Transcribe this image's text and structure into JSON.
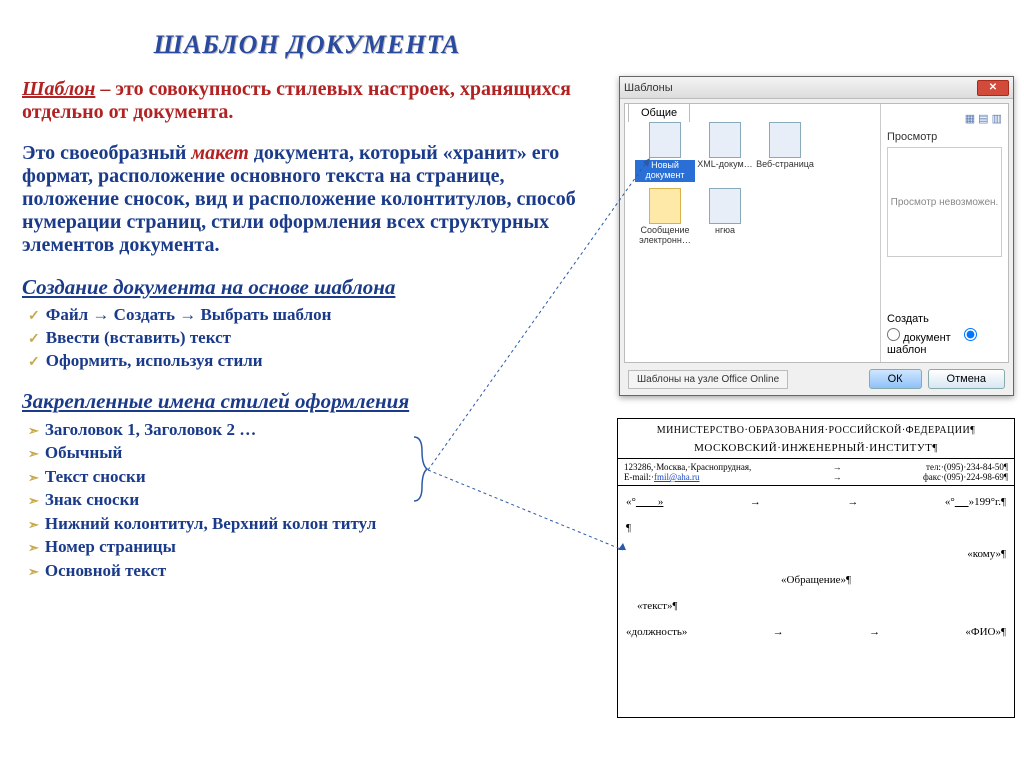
{
  "title": "ШАБЛОН ДОКУМЕНТА",
  "p1_term": "Шаблон",
  "p1_rest": " – это совокупность стилевых настроек, хранящихся отдельно от документа.",
  "p2_a": "Это своеобразный ",
  "p2_em": "макет",
  "p2_b": " документа, который  «хранит» его формат, расположение основного текста на странице, положение сносок, вид и расположение колонтитулов, способ нумерации страниц, стили оформления всех структурных элементов документа.",
  "sub1": "Создание документа на основе шаблона",
  "steps": [
    "Файл → Создать → Выбрать шаблон",
    "Ввести (вставить) текст",
    "Оформить, используя стили"
  ],
  "sub2": "Закрепленные имена стилей оформления",
  "styles": [
    "Заголовок 1, Заголовок 2 …",
    "Обычный",
    "Текст сноски",
    "Знак сноски",
    "Нижний колонтитул, Верхний колон титул",
    "Номер страницы",
    "Основной текст"
  ],
  "dialog": {
    "title": "Шаблоны",
    "tab": "Общие",
    "items": {
      "a": "Новый документ",
      "b": "XML-докум…",
      "c": "Веб-страница",
      "d": "Сообщение электронн…",
      "e": "нгюа"
    },
    "previewLbl": "Просмотр",
    "previewMsg": "Просмотр невозможен.",
    "createLbl": "Создать",
    "r1": "документ",
    "r2": "шаблон",
    "link": "Шаблоны на узле Office Online",
    "ok": "ОК",
    "cancel": "Отмена"
  },
  "doc": {
    "l1": "МИНИСТЕРСТВО·ОБРАЗОВАНИЯ·РОССИЙСКОЙ·ФЕДЕРАЦИИ¶",
    "l2": "МОСКОВСКИЙ·ИНЖЕНЕРНЫЙ·ИНСТИТУТ¶",
    "addr": "123286,·Москва,·Краснопрудная,",
    "email_lbl": "E-mail:·",
    "email": "fmil@aha.ru",
    "tel": "тел:·(095)·234-84-50¶",
    "fax": "факс·(095)·224-98-69¶",
    "dateL": "«°",
    "dateR": "199°г.¶",
    "komu": "«кому»¶",
    "obr": "«Обращение»¶",
    "text": "«текст»¶",
    "dolz": "«должность»",
    "fio": "«ФИО»¶"
  }
}
